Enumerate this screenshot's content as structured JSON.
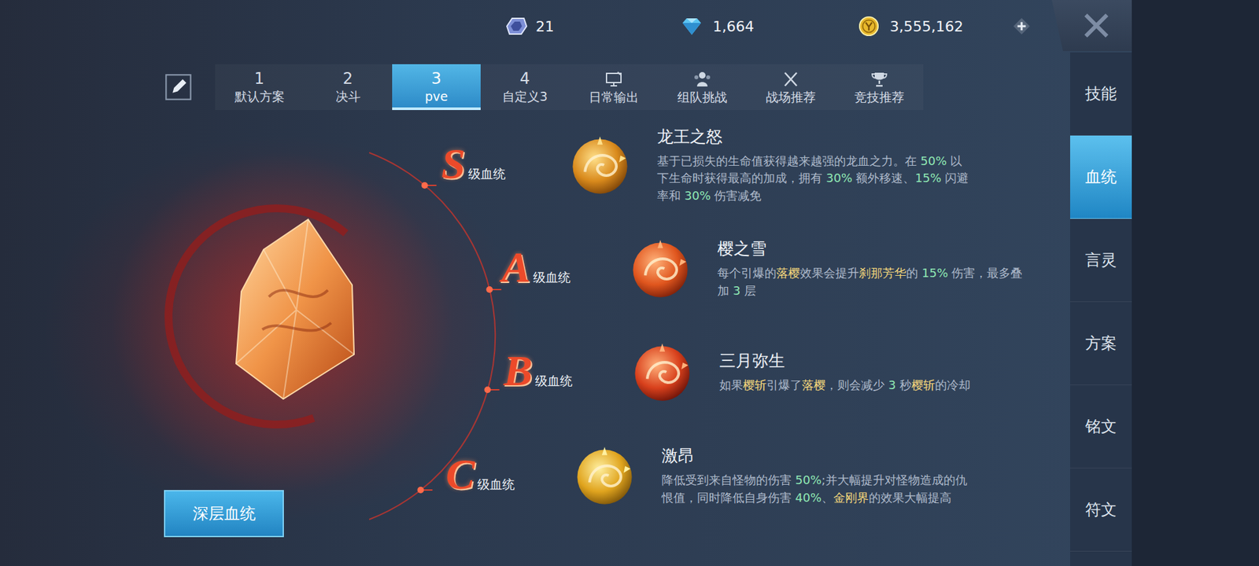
{
  "currencies": [
    {
      "kind": "crystal",
      "amount": "21"
    },
    {
      "kind": "diamond",
      "amount": "1,664"
    },
    {
      "kind": "coin",
      "amount": "3,555,162"
    }
  ],
  "plan_tabs": [
    {
      "kind": "numbered",
      "number": "1",
      "label": "默认方案",
      "selected": false
    },
    {
      "kind": "numbered",
      "number": "2",
      "label": "决斗",
      "selected": false
    },
    {
      "kind": "numbered",
      "number": "3",
      "label": "pve",
      "selected": true
    },
    {
      "kind": "numbered",
      "number": "4",
      "label": "自定义3",
      "selected": false
    },
    {
      "kind": "icon",
      "number": "",
      "label": "日常输出",
      "selected": false
    },
    {
      "kind": "icon",
      "number": "",
      "label": "组队挑战",
      "selected": false
    },
    {
      "kind": "icon",
      "number": "",
      "label": "战场推荐",
      "selected": false
    },
    {
      "kind": "icon",
      "number": "",
      "label": "竞技推荐",
      "selected": false
    }
  ],
  "sidebar": [
    {
      "label": "技能",
      "selected": false
    },
    {
      "label": "血统",
      "selected": true
    },
    {
      "label": "言灵",
      "selected": false
    },
    {
      "label": "方案",
      "selected": false
    },
    {
      "label": "铭文",
      "selected": false
    },
    {
      "label": "符文",
      "selected": false
    }
  ],
  "bloodlines": [
    {
      "grade": "S",
      "grade_label": "级血统",
      "name": "龙王之怒",
      "description": [
        {
          "text": "基于已损失的生命值获得越来越强的龙血之力。在 ",
          "kind": "plain"
        },
        {
          "text": "50%",
          "kind": "number"
        },
        {
          "text": " 以下生命时获得最高的加成，拥有 ",
          "kind": "plain"
        },
        {
          "text": "30%",
          "kind": "number"
        },
        {
          "text": " 额外移速、",
          "kind": "plain"
        },
        {
          "text": "15%",
          "kind": "number"
        },
        {
          "text": " 闪避率和 ",
          "kind": "plain"
        },
        {
          "text": "30%",
          "kind": "number"
        },
        {
          "text": " 伤害减免",
          "kind": "plain"
        }
      ]
    },
    {
      "grade": "A",
      "grade_label": "级血统",
      "name": "樱之雪",
      "description": [
        {
          "text": "每个引爆的",
          "kind": "plain"
        },
        {
          "text": "落樱",
          "kind": "skill"
        },
        {
          "text": "效果会提升",
          "kind": "plain"
        },
        {
          "text": "刹那芳华",
          "kind": "skill"
        },
        {
          "text": "的 ",
          "kind": "plain"
        },
        {
          "text": "15%",
          "kind": "number"
        },
        {
          "text": " 伤害，最多叠加 ",
          "kind": "plain"
        },
        {
          "text": "3",
          "kind": "number"
        },
        {
          "text": " 层",
          "kind": "plain"
        }
      ]
    },
    {
      "grade": "B",
      "grade_label": "级血统",
      "name": "三月弥生",
      "description": [
        {
          "text": "如果",
          "kind": "plain"
        },
        {
          "text": "樱斩",
          "kind": "skill"
        },
        {
          "text": "引爆了",
          "kind": "plain"
        },
        {
          "text": "落樱",
          "kind": "skill"
        },
        {
          "text": "，则会减少 ",
          "kind": "plain"
        },
        {
          "text": "3",
          "kind": "number"
        },
        {
          "text": " 秒",
          "kind": "plain"
        },
        {
          "text": "樱斩",
          "kind": "skill"
        },
        {
          "text": "的冷却",
          "kind": "plain"
        }
      ]
    },
    {
      "grade": "C",
      "grade_label": "级血统",
      "name": "激昂",
      "description": [
        {
          "text": "降低受到来自怪物的伤害 ",
          "kind": "plain"
        },
        {
          "text": "50%",
          "kind": "number"
        },
        {
          "text": ";并大幅提升对怪物造成的仇恨值，同时降低自身伤害 ",
          "kind": "plain"
        },
        {
          "text": "40%",
          "kind": "number"
        },
        {
          "text": "、",
          "kind": "plain"
        },
        {
          "text": "金刚界",
          "kind": "skill"
        },
        {
          "text": "的效果大幅提高",
          "kind": "plain"
        }
      ]
    }
  ],
  "deep_button": "深层血统"
}
